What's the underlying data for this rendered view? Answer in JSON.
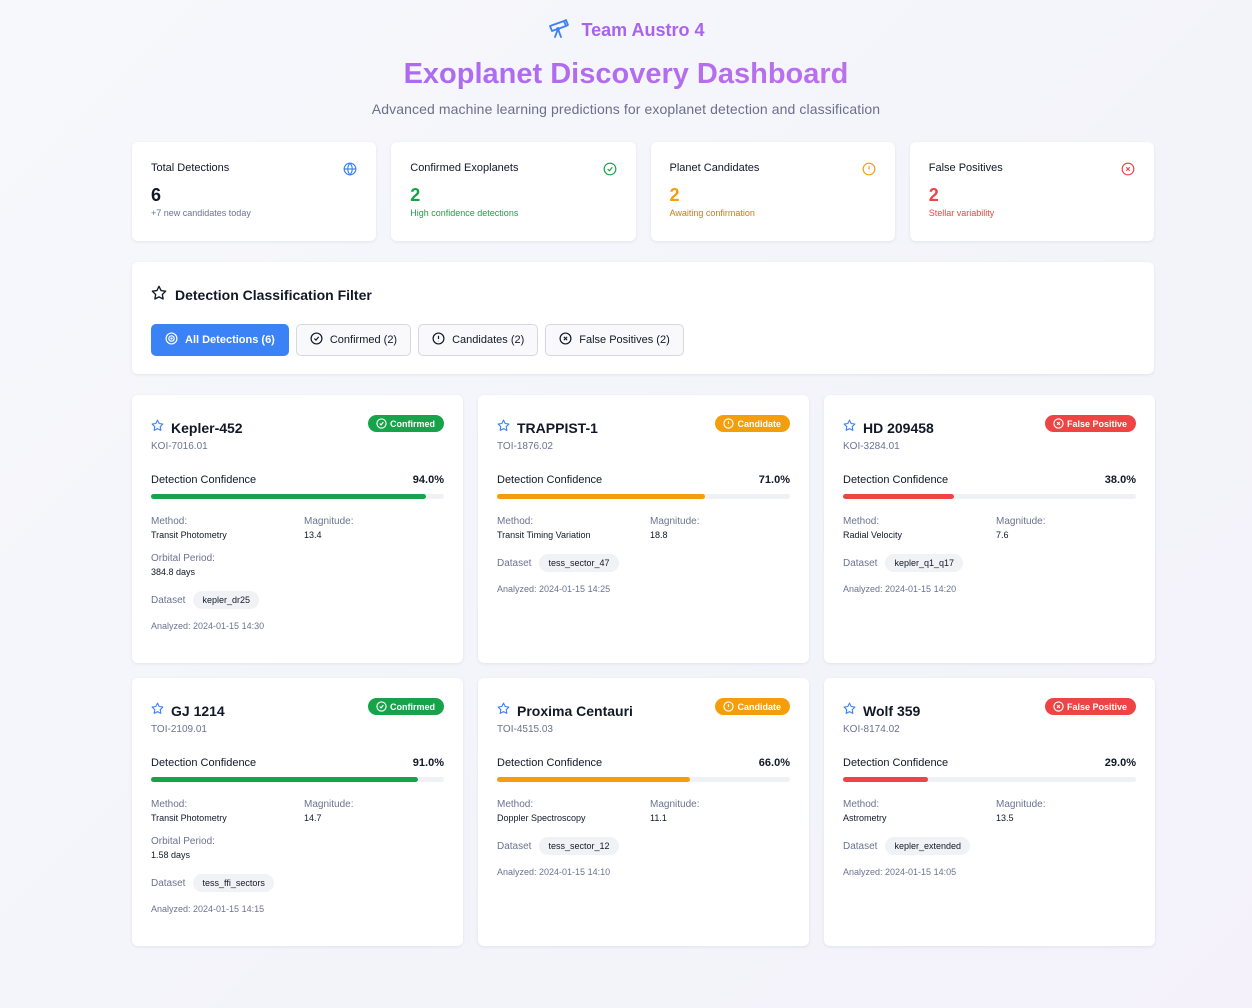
{
  "header": {
    "team": "Team Austro 4",
    "title": "Exoplanet Discovery Dashboard",
    "subtitle": "Advanced machine learning predictions for exoplanet detection and classification"
  },
  "stats": [
    {
      "label": "Total Detections",
      "value": "6",
      "sub": "+7 new candidates today",
      "icon": "globe-icon",
      "color": "#111827",
      "sub_color": "#6b7390",
      "icon_color": "#3b82f6"
    },
    {
      "label": "Confirmed Exoplanets",
      "value": "2",
      "sub": "High confidence detections",
      "icon": "check-circle-icon",
      "color": "#16a34a",
      "sub_color": "#16a34a",
      "icon_color": "#16a34a"
    },
    {
      "label": "Planet Candidates",
      "value": "2",
      "sub": "Awaiting confirmation",
      "icon": "alert-circle-icon",
      "color": "#f59e0b",
      "sub_color": "#d97706",
      "icon_color": "#f59e0b"
    },
    {
      "label": "False Positives",
      "value": "2",
      "sub": "Stellar variability",
      "icon": "x-circle-icon",
      "color": "#ef4444",
      "sub_color": "#ef4444",
      "icon_color": "#ef4444"
    }
  ],
  "filter": {
    "title": "Detection Classification Filter",
    "buttons": [
      {
        "label": "All Detections (6)",
        "icon": "target-icon",
        "active": true
      },
      {
        "label": "Confirmed (2)",
        "icon": "check-circle-icon",
        "active": false
      },
      {
        "label": "Candidates (2)",
        "icon": "alert-circle-icon",
        "active": false
      },
      {
        "label": "False Positives (2)",
        "icon": "x-circle-icon",
        "active": false
      }
    ]
  },
  "labels": {
    "confidence": "Detection Confidence",
    "method": "Method:",
    "magnitude": "Magnitude:",
    "orbital_period": "Orbital Period:",
    "dataset": "Dataset"
  },
  "colors": {
    "confirmed": "#16a34a",
    "candidate": "#f59e0b",
    "false_positive": "#ef4444",
    "accent": "#3b82f6"
  },
  "detections": [
    {
      "name": "Kepler-452",
      "id": "KOI-7016.01",
      "status": "Confirmed",
      "status_key": "confirmed",
      "confidence": 94.0,
      "confidence_label": "94.0%",
      "method": "Transit Photometry",
      "magnitude": "13.4",
      "orbital_period": "384.8 days",
      "dataset": "kepler_dr25",
      "analyzed": "Analyzed: 2024-01-15 14:30"
    },
    {
      "name": "TRAPPIST-1",
      "id": "TOI-1876.02",
      "status": "Candidate",
      "status_key": "candidate",
      "confidence": 71.0,
      "confidence_label": "71.0%",
      "method": "Transit Timing Variation",
      "magnitude": "18.8",
      "orbital_period": null,
      "dataset": "tess_sector_47",
      "analyzed": "Analyzed: 2024-01-15 14:25"
    },
    {
      "name": "HD 209458",
      "id": "KOI-3284.01",
      "status": "False Positive",
      "status_key": "false_positive",
      "confidence": 38.0,
      "confidence_label": "38.0%",
      "method": "Radial Velocity",
      "magnitude": "7.6",
      "orbital_period": null,
      "dataset": "kepler_q1_q17",
      "analyzed": "Analyzed: 2024-01-15 14:20"
    },
    {
      "name": "GJ 1214",
      "id": "TOI-2109.01",
      "status": "Confirmed",
      "status_key": "confirmed",
      "confidence": 91.0,
      "confidence_label": "91.0%",
      "method": "Transit Photometry",
      "magnitude": "14.7",
      "orbital_period": "1.58 days",
      "dataset": "tess_ffi_sectors",
      "analyzed": "Analyzed: 2024-01-15 14:15"
    },
    {
      "name": "Proxima Centauri",
      "id": "TOI-4515.03",
      "status": "Candidate",
      "status_key": "candidate",
      "confidence": 66.0,
      "confidence_label": "66.0%",
      "method": "Doppler Spectroscopy",
      "magnitude": "11.1",
      "orbital_period": null,
      "dataset": "tess_sector_12",
      "analyzed": "Analyzed: 2024-01-15 14:10"
    },
    {
      "name": "Wolf 359",
      "id": "KOI-8174.02",
      "status": "False Positive",
      "status_key": "false_positive",
      "confidence": 29.0,
      "confidence_label": "29.0%",
      "method": "Astrometry",
      "magnitude": "13.5",
      "orbital_period": null,
      "dataset": "kepler_extended",
      "analyzed": "Analyzed: 2024-01-15 14:05"
    }
  ]
}
